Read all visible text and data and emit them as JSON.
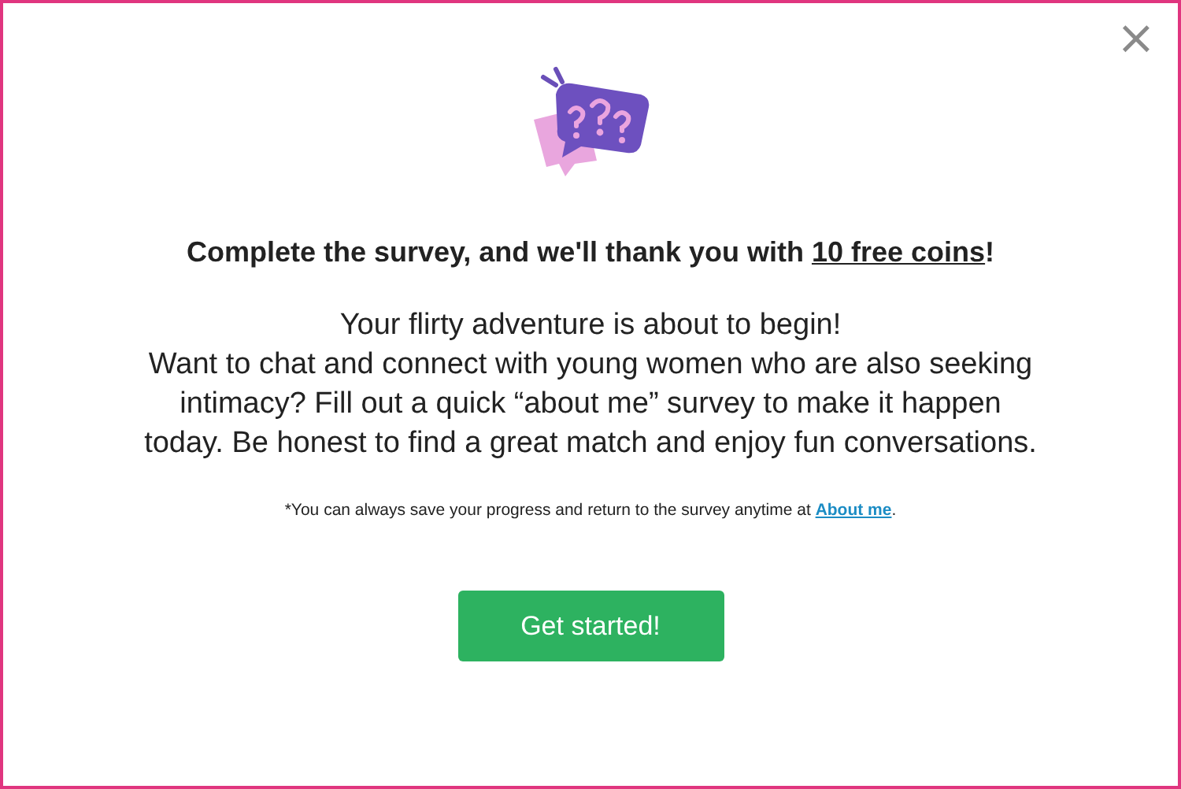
{
  "dialog": {
    "close": "×",
    "headline": {
      "before": "Complete the survey, and we'll thank you with ",
      "link": "10 free coins",
      "after": "!"
    },
    "paragraphs": [
      "Your flirty adventure is about to begin!",
      "Want to chat and connect with young women who are also seeking intimacy? Fill out a quick “about me” survey to make it happen today. Be honest to find a great match and enjoy fun conversations."
    ],
    "footnote": {
      "before": "*You can always save your progress and return to the survey anytime at ",
      "link": "About me",
      "after": "."
    },
    "button": "Get started!"
  }
}
